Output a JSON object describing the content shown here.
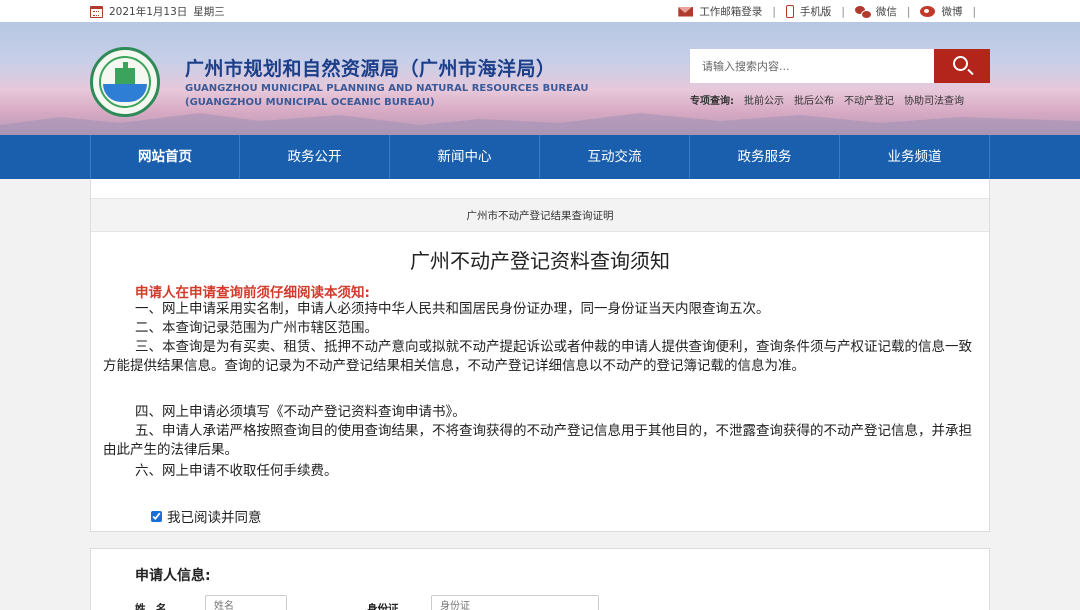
{
  "topbar": {
    "date": "2021年1月13日",
    "weekday": "星期三",
    "links": [
      "工作邮箱登录",
      "手机版",
      "微信",
      "微博"
    ]
  },
  "header": {
    "title_cn": "广州市规划和自然资源局（广州市海洋局）",
    "title_en_1": "GUANGZHOU MUNICIPAL PLANNING AND NATURAL RESOURCES BUREAU",
    "title_en_2": "(GUANGZHOU MUNICIPAL OCEANIC BUREAU)",
    "search_placeholder": "请输入搜索内容...",
    "quick_label": "专项查询:",
    "quick_links": [
      "批前公示",
      "批后公布",
      "不动产登记",
      "协助司法查询"
    ]
  },
  "nav": [
    "网站首页",
    "政务公开",
    "新闻中心",
    "互动交流",
    "政务服务",
    "业务频道"
  ],
  "breadcrumb": "广州市不动产登记结果查询证明",
  "notice": {
    "title": "广州不动产登记资料查询须知",
    "warning": "申请人在申请查询前须仔细阅读本须知:",
    "items": [
      "一、网上申请采用实名制，申请人必须持中华人民共和国居民身份证办理，同一身份证当天内限查询五次。",
      "二、本查询记录范围为广州市辖区范围。",
      "三、本查询是为有买卖、租赁、抵押不动产意向或拟就不动产提起诉讼或者仲裁的申请人提供查询便利，查询条件须与产权证记载的信息一致方能提供结果信息。查询的记录为不动产登记结果相关信息，不动产登记详细信息以不动产的登记簿记载的信息为准。",
      "四、网上申请必须填写《不动产登记资料查询申请书》。",
      "五、申请人承诺严格按照查询目的使用查询结果，不将查询获得的不动产登记信息用于其他目的，不泄露查询获得的不动产登记信息，并承担由此产生的法律后果。",
      "六、网上申请不收取任何手续费。"
    ],
    "agree_label": "我已阅读并同意",
    "agree_checked": true
  },
  "applicant": {
    "title": "申请人信息:",
    "name_label": "姓　名",
    "name_placeholder": "姓名",
    "id_label": "身份证",
    "id_placeholder": "身份证"
  },
  "colors": {
    "nav_bg": "#1a5fae",
    "search_btn": "#b3251b",
    "warning": "#d23a2b",
    "title_blue": "#1d3f8a"
  },
  "icons": [
    "calendar-icon",
    "mail-icon",
    "phone-icon",
    "wechat-icon",
    "weibo-icon",
    "search-icon"
  ]
}
